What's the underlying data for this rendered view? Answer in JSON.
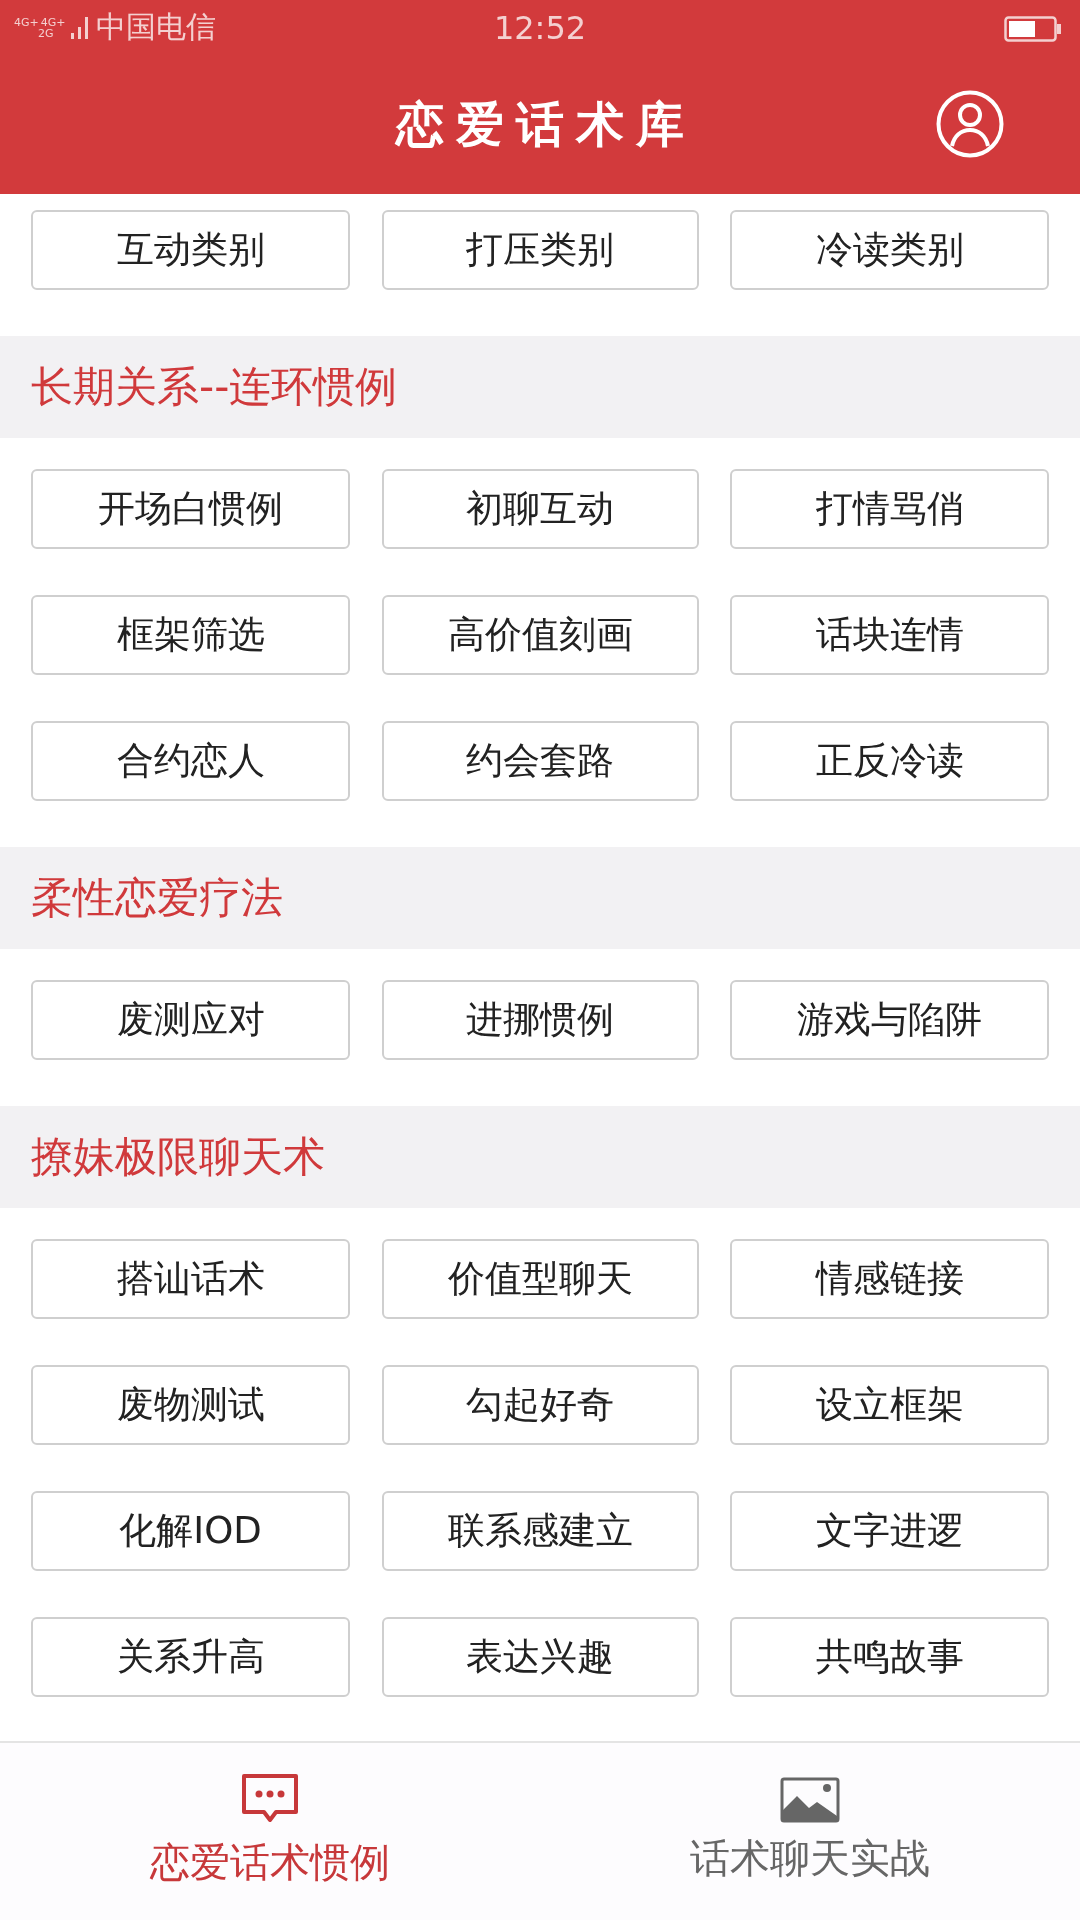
{
  "status_bar": {
    "network_labels": [
      "4G+",
      "4G+",
      "2G"
    ],
    "carrier": "中国电信",
    "time": "12:52"
  },
  "header": {
    "title": "恋爱话术库"
  },
  "groups": [
    {
      "items": [
        "互动类别",
        "打压类别",
        "冷读类别"
      ]
    },
    {
      "title": "长期关系--连环惯例",
      "items": [
        "开场白惯例",
        "初聊互动",
        "打情骂俏",
        "框架筛选",
        "高价值刻画",
        "话块连情",
        "合约恋人",
        "约会套路",
        "正反冷读"
      ]
    },
    {
      "title": "柔性恋爱疗法",
      "items": [
        "废测应对",
        "进挪惯例",
        "游戏与陷阱"
      ]
    },
    {
      "title": "撩妹极限聊天术",
      "items": [
        "搭讪话术",
        "价值型聊天",
        "情感链接",
        "废物测试",
        "勾起好奇",
        "设立框架",
        "化解IOD",
        "联系感建立",
        "文字进逻",
        "关系升高",
        "表达兴趣",
        "共鸣故事"
      ]
    }
  ],
  "tab_bar": [
    {
      "label": "恋爱话术惯例",
      "kind": "chat",
      "selected": true
    },
    {
      "label": "话术聊天实战",
      "kind": "image",
      "selected": false
    }
  ]
}
